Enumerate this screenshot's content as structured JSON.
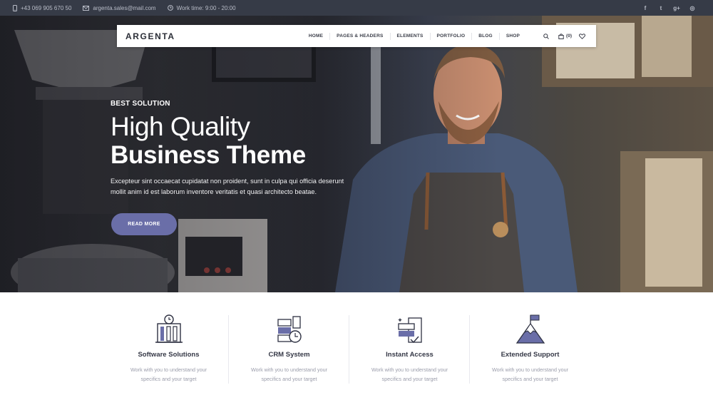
{
  "topbar": {
    "phone": "+43 069 905 670 50",
    "email": "argenta.sales@mail.com",
    "hours": "Work time: 9:00 - 20:00",
    "socials": [
      {
        "icon": "facebook-icon",
        "glyph": "f"
      },
      {
        "icon": "twitter-icon",
        "glyph": "t"
      },
      {
        "icon": "google-plus-icon",
        "glyph": "g+"
      },
      {
        "icon": "instagram-icon",
        "glyph": "◎"
      }
    ]
  },
  "nav": {
    "logo": "ARGENTA",
    "items": [
      "HOME",
      "PAGES & HEADERS",
      "ELEMENTS",
      "PORTFOLIO",
      "BLOG",
      "SHOP"
    ],
    "cart_count": "(0)"
  },
  "hero": {
    "kicker": "BEST SOLUTION",
    "title_line1": "High Quality",
    "title_line2": "Business Theme",
    "description_line1": "Excepteur sint occaecat cupidatat non proident, sunt in culpa qui officia deserunt",
    "description_line2": "mollit anim id est laborum inventore veritatis et quasi architecto beatae.",
    "cta_label": "READ MORE",
    "accent_color": "#6a6ea8"
  },
  "features": [
    {
      "icon": "software-solutions-icon",
      "title": "Software Solutions",
      "line1": "Work with you to understand your",
      "line2": "specifics and your target"
    },
    {
      "icon": "crm-system-icon",
      "title": "CRM System",
      "line1": "Work with you to understand your",
      "line2": "specifics and your target"
    },
    {
      "icon": "instant-access-icon",
      "title": "Instant Access",
      "line1": "Work with you to understand your",
      "line2": "specifics and your target"
    },
    {
      "icon": "extended-support-icon",
      "title": "Extended Support",
      "line1": "Work with you to understand your",
      "line2": "specifics and your target"
    }
  ],
  "colors": {
    "topbar_bg": "#363b47",
    "icon_stroke": "#2e3142",
    "icon_accent": "#6a6ea8"
  }
}
